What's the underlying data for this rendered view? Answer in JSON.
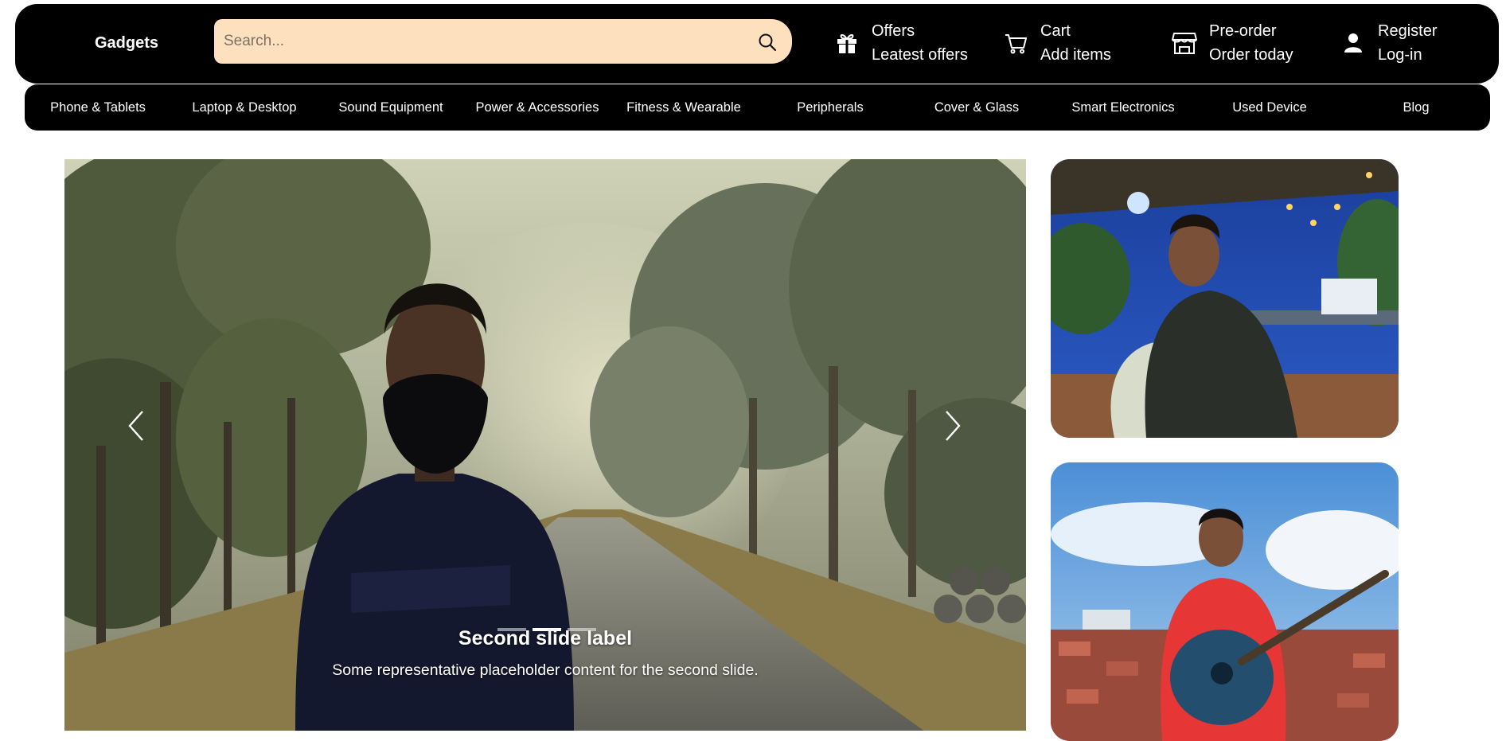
{
  "header": {
    "brand": "Gadgets",
    "search": {
      "placeholder": "Search..."
    },
    "items": [
      {
        "icon": "gift-icon",
        "title": "Offers",
        "subtitle": "Leatest offers"
      },
      {
        "icon": "cart-icon",
        "title": "Cart",
        "subtitle": "Add items"
      },
      {
        "icon": "store-icon",
        "title": "Pre-order",
        "subtitle": "Order today"
      },
      {
        "icon": "user-icon",
        "title": "Register",
        "subtitle": "Log-in"
      }
    ]
  },
  "categories": [
    "Phone & Tablets",
    "Laptop & Desktop",
    "Sound Equipment",
    "Power & Accessories",
    "Fitness & Wearable",
    "Peripherals",
    "Cover & Glass",
    "Smart Electronics",
    "Used Device",
    "Blog"
  ],
  "carousel": {
    "active_index": 1,
    "slide_count": 3,
    "caption_title": "Second slide label",
    "caption_text": "Some representative placeholder content for the second slide."
  },
  "colors": {
    "bar_background": "#000000",
    "search_background": "#fde0bd",
    "text_on_dark": "#ffffff"
  }
}
